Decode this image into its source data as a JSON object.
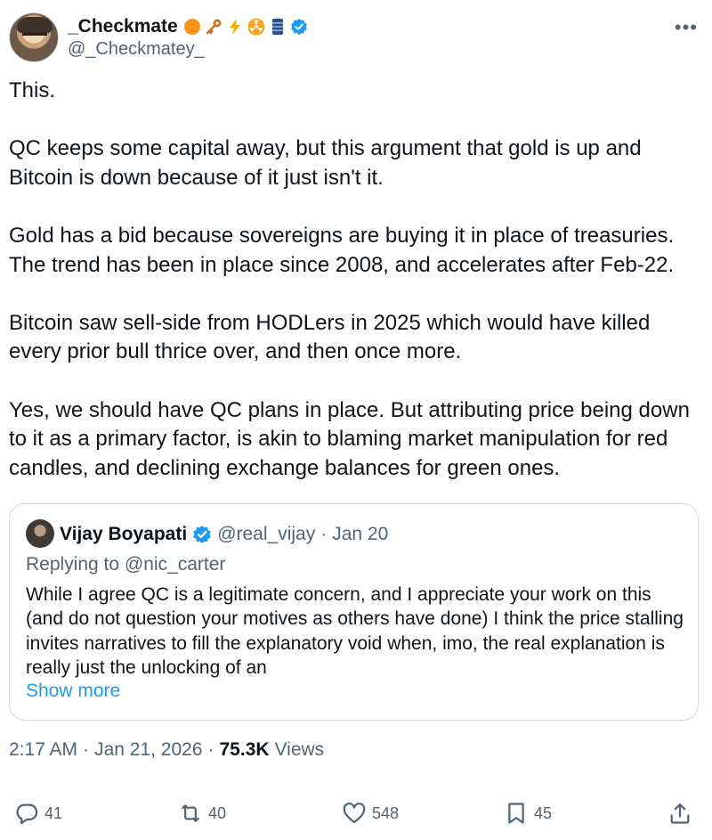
{
  "author": {
    "display_name": "_Checkmate",
    "handle": "@_Checkmatey_",
    "badges": [
      "orange-circle-icon",
      "key-icon",
      "lightning-icon",
      "radioactive-icon",
      "barrel-icon",
      "verified-badge-icon"
    ]
  },
  "tweet": {
    "text": "This.\n\nQC keeps some capital away, but this argument that gold is up and Bitcoin is down because of it just isn't it.\n\nGold has a bid because sovereigns are buying it in place of treasuries. The trend has been in place since 2008, and accelerates after Feb-22.\n\nBitcoin saw sell-side from HODLers in 2025 which would have killed every prior bull thrice over, and then once more.\n\nYes, we should have QC plans in place. But attributing price being down to it as a primary factor, is akin to blaming market manipulation for red candles, and declining exchange balances for green ones."
  },
  "quote": {
    "name": "Vijay Boyapati",
    "handle": "@real_vijay",
    "separator": "·",
    "date": "Jan 20",
    "replying_to": "Replying to @nic_carter",
    "body": "While I agree QC is a legitimate concern, and I appreciate your work on this (and do not question your motives as others have done) I think the price stalling invites narratives to fill the explanatory void when, imo, the real explanation is really just the unlocking of an",
    "show_more": "Show more"
  },
  "meta": {
    "time": "2:17 AM",
    "sep1": "·",
    "date": "Jan 21, 2026",
    "sep2": "·",
    "views_count": "75.3K",
    "views_label": "Views"
  },
  "actions": {
    "replies": "41",
    "reposts": "40",
    "likes": "548",
    "bookmarks": "45"
  },
  "colors": {
    "text": "#0f1419",
    "secondary": "#536471",
    "link": "#1d9bf0",
    "verified": "#1d9bf0",
    "border": "#cfd9de"
  }
}
